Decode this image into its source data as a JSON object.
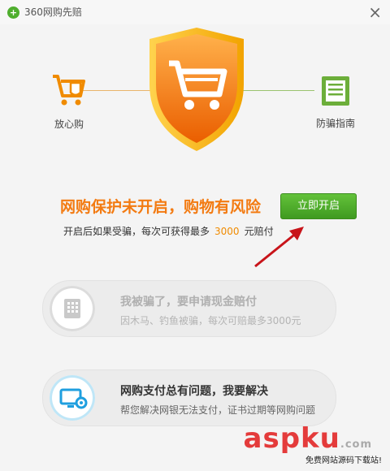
{
  "window": {
    "title": "360网购先赔",
    "close_symbol": "×"
  },
  "features": {
    "left": {
      "label": "放心购",
      "icon": "shopping-cart-shield-icon"
    },
    "right": {
      "label": "防骗指南",
      "icon": "guide-document-icon"
    }
  },
  "hero": {
    "shield_icon": "orange-shield-cart-icon",
    "colors": {
      "orange": "#f57c00",
      "green": "#5bb12f"
    }
  },
  "status": {
    "title": "网购保护未开启，购物有风险",
    "subtitle_prefix": "开启后如果受骗，每次可获得最多",
    "amount": "3000",
    "subtitle_suffix": "元赔付"
  },
  "buttons": {
    "enable_label": "立即开启"
  },
  "cards": [
    {
      "title": "我被骗了，要申请现金赔付",
      "desc": "因木马、钓鱼被骗，每次可赔最多3000元",
      "icon": "grid-document-icon"
    },
    {
      "title": "网购支付总有问题，我要解决",
      "desc": "帮您解决网银无法支付，证书过期等网购问题",
      "icon": "monitor-gear-icon"
    }
  ],
  "watermark": {
    "brand": "aspku",
    "suffix": ".com",
    "tagline": "免费网站源码下载站!"
  }
}
